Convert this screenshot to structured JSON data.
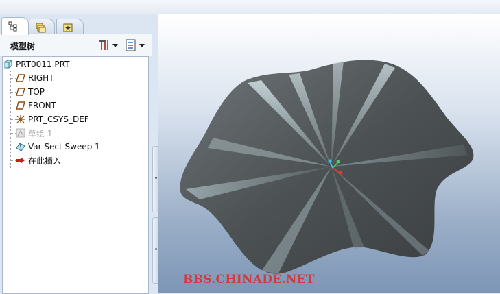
{
  "left_panel": {
    "tabs": [
      {
        "name": "model-tree-tab",
        "active": true
      },
      {
        "name": "folder-browser-tab",
        "active": false
      },
      {
        "name": "favorites-tab",
        "active": false
      }
    ],
    "title": "模型树",
    "tools": [
      {
        "name": "settings-tool",
        "icon": "tools-icon"
      },
      {
        "name": "show-tool",
        "icon": "list-settings-icon"
      }
    ],
    "tree": {
      "root": {
        "label": "PRT0011.PRT",
        "icon": "part-icon"
      },
      "children": [
        {
          "label": "RIGHT",
          "icon": "datum-plane-icon",
          "disabled": false
        },
        {
          "label": "TOP",
          "icon": "datum-plane-icon",
          "disabled": false
        },
        {
          "label": "FRONT",
          "icon": "datum-plane-icon",
          "disabled": false
        },
        {
          "label": "PRT_CSYS_DEF",
          "icon": "coordinate-system-icon",
          "disabled": false
        },
        {
          "label": "草绘 1",
          "icon": "sketch-icon",
          "disabled": true
        },
        {
          "label": "Var Sect Sweep 1",
          "icon": "sweep-feature-icon",
          "disabled": false
        },
        {
          "label": "在此插入",
          "icon": "insert-here-arrow-icon",
          "disabled": false
        }
      ]
    }
  },
  "viewport": {
    "watermark": "BBS.CHINADE.NET",
    "colors": {
      "shape": "#5b5f62",
      "highlight": "#c4d6dc",
      "axis_y": "#3fc0dc",
      "axis_x": "#e23a2a",
      "axis_z": "#45d06a",
      "watermark": "#d23b3b"
    }
  }
}
